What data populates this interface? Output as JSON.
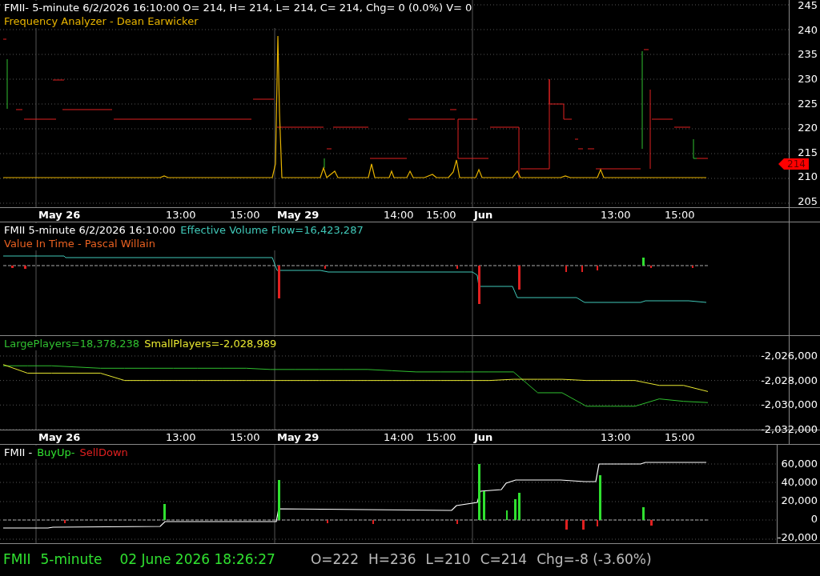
{
  "panels": [
    {
      "kind": "price",
      "legend": [
        [
          {
            "text": "FMII- 5-minute 6/2/2026 16:10:00 O= 214, H= 214, L= 214, C= 214, Chg= 0 (0.0%) V= 0",
            "color": "#ffffff"
          }
        ],
        [
          {
            "text": "Frequency Analyzer - Dean Earwicker",
            "color": "#e8b400"
          }
        ]
      ],
      "yticks": [
        "245",
        "240",
        "235",
        "230",
        "225",
        "220",
        "215",
        "210",
        "205"
      ],
      "price_tag": "214"
    },
    {
      "kind": "flow",
      "legend": [
        [
          {
            "text": "FMII 5-minute  6/2/2026 16:10:00",
            "color": "#ffffff"
          },
          {
            "text": "Effective Volume Flow=16,423,287",
            "color": "#40c8b8"
          }
        ],
        [
          {
            "text": "Value In Time - Pascal Willain",
            "color": "#e86020"
          }
        ]
      ]
    },
    {
      "kind": "players",
      "legend": [
        [
          {
            "text": "LargePlayers=18,378,238",
            "color": "#30c030"
          },
          {
            "text": "SmallPlayers=-2,028,989",
            "color": "#e8e830"
          }
        ]
      ],
      "chart_data": {
        "type": "line",
        "categories": [
          null,
          null,
          null,
          null,
          null,
          null,
          null,
          null,
          null,
          null,
          null,
          null,
          null,
          null,
          null,
          null,
          null,
          null,
          null,
          null,
          null,
          null,
          null,
          null,
          null,
          null,
          null,
          null,
          null,
          null
        ],
        "ylim": [
          -2032070,
          -2024370
        ],
        "grid": true,
        "yticks": [
          {
            "value": -2026000,
            "label": "-2,026,000"
          },
          {
            "value": -2028000,
            "label": "-2,028,000"
          },
          {
            "value": -2030000,
            "label": "-2,030,000"
          },
          {
            "value": -2032000,
            "label": "-2,032,000"
          }
        ],
        "series": [
          {
            "color": "#30c030",
            "values": [
              -2026800,
              -2026800,
              -2026800,
              -2026900,
              -2027000,
              -2027000,
              -2027000,
              -2027000,
              -2027000,
              -2027000,
              -2027000,
              -2027100,
              -2027100,
              -2027100,
              -2027100,
              -2027100,
              -2027200,
              -2027300,
              -2027300,
              -2027300,
              -2027300,
              -2027300,
              -2029000,
              -2029000,
              -2030100,
              -2030100,
              -2030100,
              -2029500,
              -2029700,
              -2029800
            ]
          },
          {
            "color": "#e8e830",
            "values": [
              -2026700,
              -2027400,
              -2027400,
              -2027400,
              -2027400,
              -2028000,
              -2028000,
              -2028000,
              -2028000,
              -2028000,
              -2028000,
              -2028000,
              -2028000,
              -2028000,
              -2028000,
              -2028000,
              -2028000,
              -2028000,
              -2028000,
              -2028000,
              -2028000,
              -2027900,
              -2027900,
              -2027900,
              -2028000,
              -2028000,
              -2028000,
              -2028400,
              -2028400,
              -2028900
            ]
          }
        ]
      }
    },
    {
      "kind": "buysell",
      "legend": [
        [
          {
            "text": "FMII -",
            "color": "#ffffff"
          },
          {
            "text": "BuyUp-",
            "color": "#30e030"
          },
          {
            "text": "SellDown",
            "color": "#e02020"
          }
        ]
      ],
      "yticks": [
        "60,000",
        "40,000",
        "20,000",
        "0",
        "-20,000"
      ]
    }
  ],
  "date_axes": [
    [
      {
        "text": "May 26",
        "bold": true
      },
      {
        "text": "13:00",
        "bold": false
      },
      {
        "text": "15:00",
        "bold": false
      },
      {
        "text": "May 29",
        "bold": true
      },
      {
        "text": "14:00",
        "bold": false
      },
      {
        "text": "15:00",
        "bold": false
      },
      {
        "text": "Jun",
        "bold": true
      },
      {
        "text": "13:00",
        "bold": false
      },
      {
        "text": "15:00",
        "bold": false
      }
    ],
    [
      {
        "text": "May 26",
        "bold": true
      },
      {
        "text": "13:00",
        "bold": false
      },
      {
        "text": "15:00",
        "bold": false
      },
      {
        "text": "May 29",
        "bold": true
      },
      {
        "text": "14:00",
        "bold": false
      },
      {
        "text": "15:00",
        "bold": false
      },
      {
        "text": "Jun",
        "bold": true
      },
      {
        "text": "13:00",
        "bold": false
      },
      {
        "text": "15:00",
        "bold": false
      }
    ]
  ],
  "status_bar": {
    "symbol": "FMII",
    "interval": "5-minute",
    "datetime": "02 June 2026 18:26:27",
    "values": [
      "O=222",
      "H=236",
      "L=210",
      "C=214",
      "Chg=-8 (-3.60%)"
    ]
  }
}
